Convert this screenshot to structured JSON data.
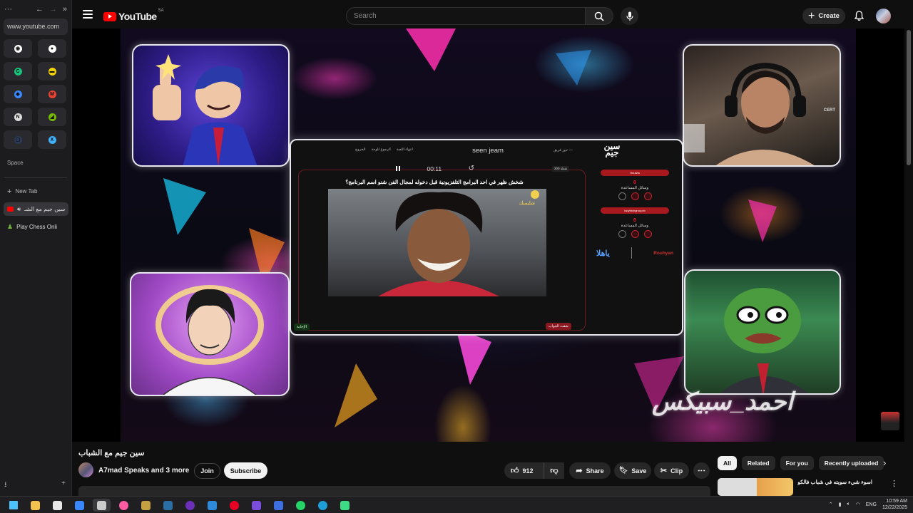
{
  "browser": {
    "nav": {
      "menu": "···",
      "back": "←",
      "forward": "→",
      "expand": "»"
    },
    "url": "www.youtube.com",
    "space_label": "Space",
    "new_tab": "New Tab",
    "tabs": [
      {
        "label": "سين جيم مع الشـ",
        "color": "#ff2a2a"
      },
      {
        "label": "Play Chess Onli",
        "color": "#6fb33b"
      }
    ],
    "favorites": [
      {
        "glyph": "◉",
        "color": "#ffffff"
      },
      {
        "glyph": "●",
        "color": "#ffffff"
      },
      {
        "glyph": "C",
        "color": "#19c37d"
      },
      {
        "glyph": "▬",
        "color": "#f5d20a"
      },
      {
        "glyph": "◆",
        "color": "#3a88ff"
      },
      {
        "glyph": "M",
        "color": "#ea4335"
      },
      {
        "glyph": "N",
        "color": "#dddddd"
      },
      {
        "glyph": "◢",
        "color": "#76b900"
      },
      {
        "glyph": "▢",
        "color": "#2b3a56"
      },
      {
        "glyph": "X",
        "color": "#3fb2ff"
      }
    ],
    "download": "⭳",
    "add": "+"
  },
  "youtube": {
    "logo_text": "YouTube",
    "country": "SA",
    "search_placeholder": "Search",
    "create_label": "Create"
  },
  "video": {
    "quiz": {
      "brand": "سين جيم",
      "title": "seen jeam",
      "links": [
        "الخروج",
        "الرجوع للوحة",
        "انتهاء اللعبة"
      ],
      "turn": "دور فريق: —",
      "timer": "00:11",
      "points_badge": "نقطة 200",
      "question": "شخش ظهر في احد البرامج التلفزيونية قبل دخوله لمجال الفن شنو اسم البرنامج؟",
      "answer_button": "الإجابة",
      "reveal_button": "شفت الجواب",
      "teams": [
        {
          "name": "Houwta",
          "score": "0",
          "aids_label": "وسائل المساعدة"
        },
        {
          "name": "ladybtchgroupzb",
          "score": "0",
          "aids_label": "وسائل المساعدة"
        }
      ],
      "sponsor_left": "ياهلا",
      "sponsor_right": "Rouhyan",
      "image_label": "شليمبك"
    },
    "watermark": "احمد_سبيكس",
    "cam_logo": "CERT"
  },
  "below": {
    "title": "سين جيم مع الشباب",
    "channel": "A7mad Speaks and 3 more",
    "join": "Join",
    "subscribe": "Subscribe",
    "likes": "912",
    "share": "Share",
    "save": "Save",
    "clip": "Clip",
    "more": "⋮",
    "chips": [
      "All",
      "Related",
      "For you",
      "Recently uploaded"
    ],
    "chip_next": "›",
    "recommendation_title": "اسوء شيء سويته في شباب فالكونز ..",
    "rec_menu": "⋮"
  },
  "taskbar": {
    "lang": "ENG",
    "time": "10:59 AM",
    "date": "12/22/2025",
    "apps": [
      {
        "name": "windows",
        "color": "#4cc2ff"
      },
      {
        "name": "file-explorer",
        "color": "#f2c14e"
      },
      {
        "name": "calendar",
        "color": "#e8e8e8"
      },
      {
        "name": "mail",
        "color": "#3a88ff"
      },
      {
        "name": "chrome-like",
        "color": "#cccccc"
      },
      {
        "name": "arc",
        "color": "#ff5ba3"
      },
      {
        "name": "media",
        "color": "#c4a040"
      },
      {
        "name": "steam",
        "color": "#2a6ea5"
      },
      {
        "name": "obs",
        "color": "#6b2fb8"
      },
      {
        "name": "vscode",
        "color": "#2e8ad8"
      },
      {
        "name": "pinterest",
        "color": "#e60023"
      },
      {
        "name": "jetbrains",
        "color": "#7b4ddb"
      },
      {
        "name": "app-blue",
        "color": "#3d6fe0"
      },
      {
        "name": "whatsapp",
        "color": "#25d366"
      },
      {
        "name": "edge",
        "color": "#1e9ed8"
      },
      {
        "name": "terminal-green",
        "color": "#3ddc84"
      }
    ]
  }
}
